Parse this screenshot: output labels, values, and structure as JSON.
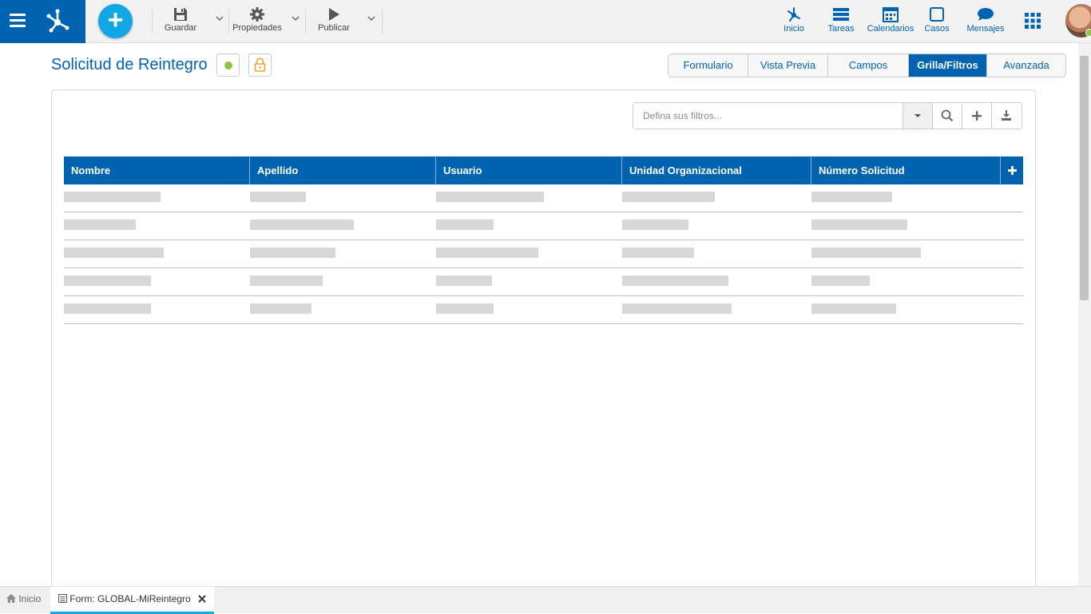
{
  "toolbar": {
    "save_label": "Guardar",
    "properties_label": "Propiedades",
    "publish_label": "Publicar"
  },
  "nav": {
    "home": "Inicio",
    "tasks": "Tareas",
    "calendars": "Calendarios",
    "cases": "Casos",
    "messages": "Mensajes"
  },
  "page": {
    "title": "Solicitud de Reintegro"
  },
  "tabs": [
    {
      "label": "Formulario"
    },
    {
      "label": "Vista Previa"
    },
    {
      "label": "Campos"
    },
    {
      "label": "Grilla/Filtros",
      "active": true
    },
    {
      "label": "Avanzada"
    }
  ],
  "filter": {
    "placeholder": "Defina sus filtros..."
  },
  "grid": {
    "columns": [
      "Nombre",
      "Apellido",
      "Usuario",
      "Unidad Organizacional",
      "Número Solicitud"
    ],
    "rows": 5
  },
  "bottom": {
    "home_tab": "Inicio",
    "form_tab": "Form: GLOBAL-MiReintegro"
  },
  "colors": {
    "primary": "#0063b1",
    "accent": "#11a7e6",
    "status_green": "#8cc63f",
    "lock_orange": "#f0a030"
  }
}
